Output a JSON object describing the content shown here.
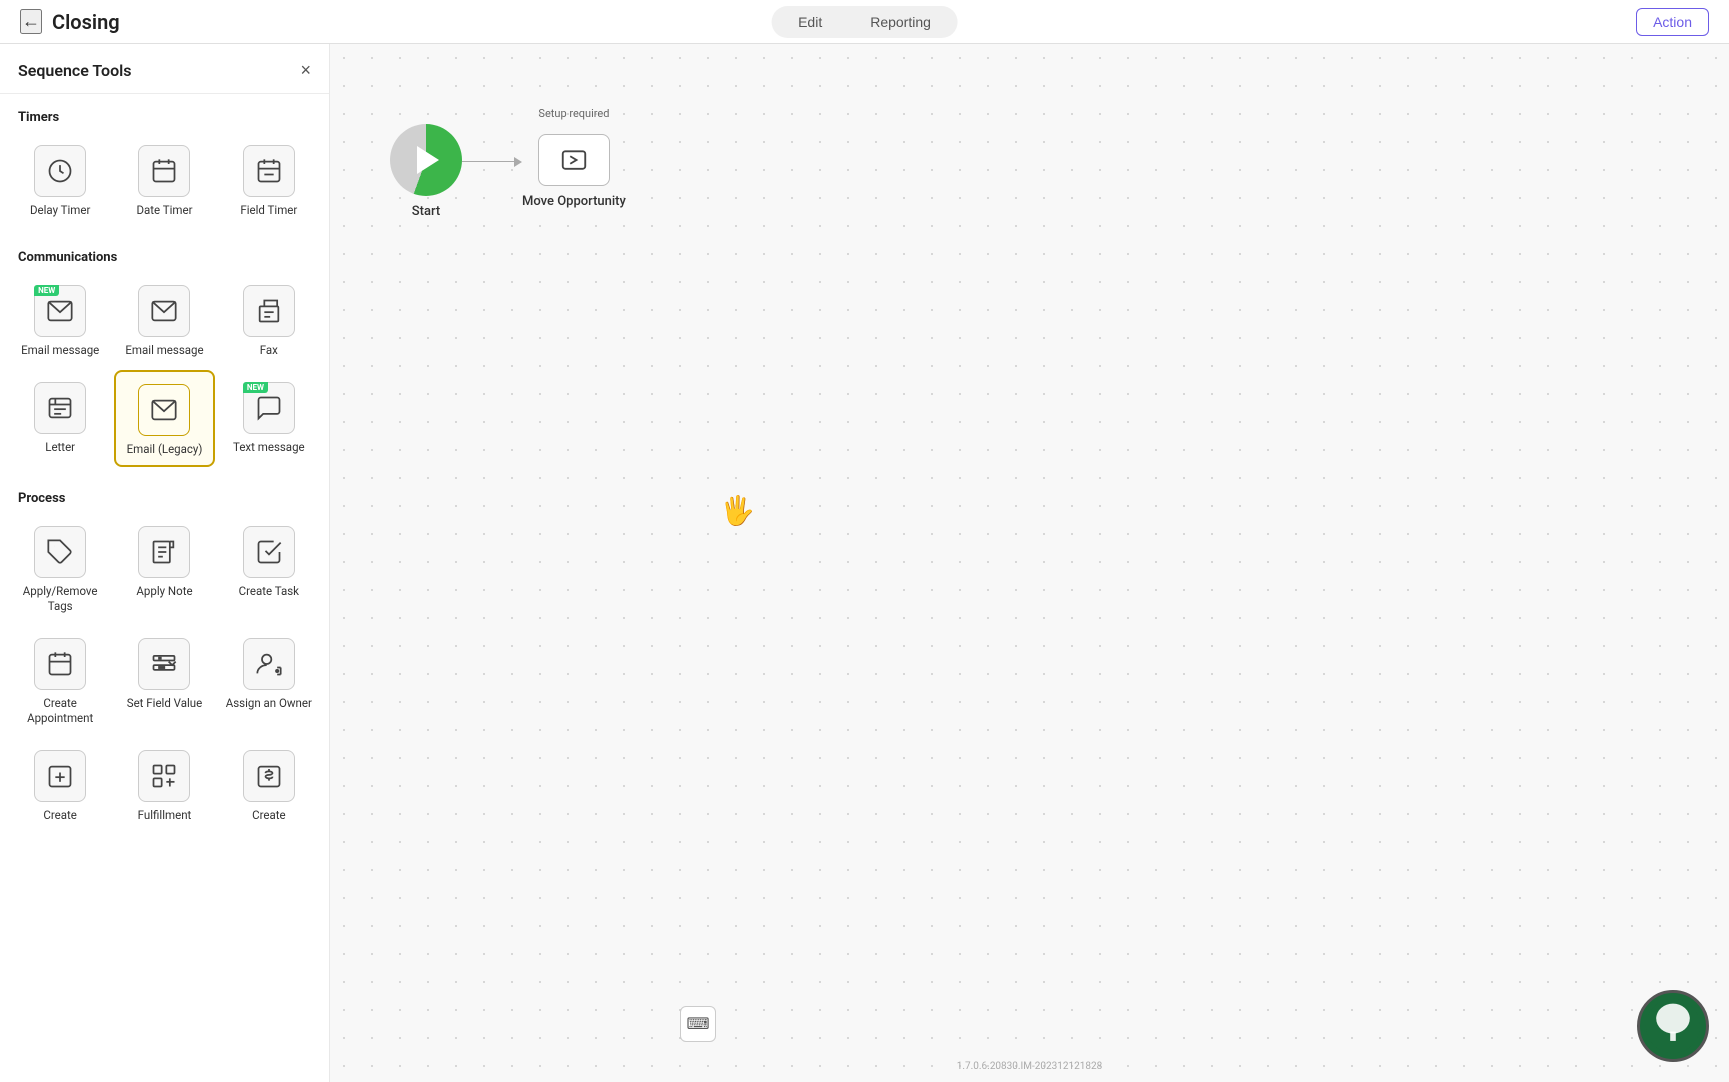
{
  "header": {
    "back_icon": "←",
    "title": "Closing",
    "tabs": [
      {
        "label": "Edit",
        "active": false
      },
      {
        "label": "Reporting",
        "active": false
      }
    ],
    "action_button": "Action"
  },
  "sidebar": {
    "title": "Sequence Tools",
    "close_icon": "×",
    "sections": [
      {
        "label": "Timers",
        "tools": [
          {
            "id": "delay-timer",
            "label": "Delay Timer",
            "icon": "clock"
          },
          {
            "id": "date-timer",
            "label": "Date Timer",
            "icon": "calendar"
          },
          {
            "id": "field-timer",
            "label": "Field Timer",
            "icon": "calendar-field"
          }
        ]
      },
      {
        "label": "Communications",
        "tools": [
          {
            "id": "email-message-new",
            "label": "Email message",
            "icon": "email",
            "badge": "NEW"
          },
          {
            "id": "email-message-2",
            "label": "Email message",
            "icon": "email"
          },
          {
            "id": "fax",
            "label": "Fax",
            "icon": "fax"
          },
          {
            "id": "letter",
            "label": "Letter",
            "icon": "letter"
          },
          {
            "id": "email-legacy",
            "label": "Email (Legacy)",
            "icon": "email",
            "selected": true
          },
          {
            "id": "text-message",
            "label": "Text message",
            "icon": "text-msg",
            "badge": "NEW"
          }
        ]
      },
      {
        "label": "Process",
        "tools": [
          {
            "id": "apply-remove-tags",
            "label": "Apply/Remove Tags",
            "icon": "tag"
          },
          {
            "id": "apply-note",
            "label": "Apply Note",
            "icon": "note"
          },
          {
            "id": "create-task",
            "label": "Create Task",
            "icon": "task"
          },
          {
            "id": "create-appointment",
            "label": "Create Appointment",
            "icon": "appt"
          },
          {
            "id": "set-field-value",
            "label": "Set Field Value",
            "icon": "field-value"
          },
          {
            "id": "assign-owner",
            "label": "Assign an Owner",
            "icon": "assign-owner"
          },
          {
            "id": "create-1",
            "label": "Create",
            "icon": "create-plus"
          },
          {
            "id": "fulfillment",
            "label": "Fulfillment",
            "icon": "fulfillment"
          },
          {
            "id": "create-2",
            "label": "Create",
            "icon": "create-dollar"
          }
        ]
      }
    ]
  },
  "canvas": {
    "start_node": {
      "label": "Start"
    },
    "nodes": [
      {
        "id": "move-opportunity",
        "label": "Move Opportunity",
        "setup_required": "Setup required"
      }
    ]
  },
  "version_label": "1.7.0.6.20830.IM-202312121828",
  "toolbar": {
    "keyboard_icon": "⌨"
  }
}
